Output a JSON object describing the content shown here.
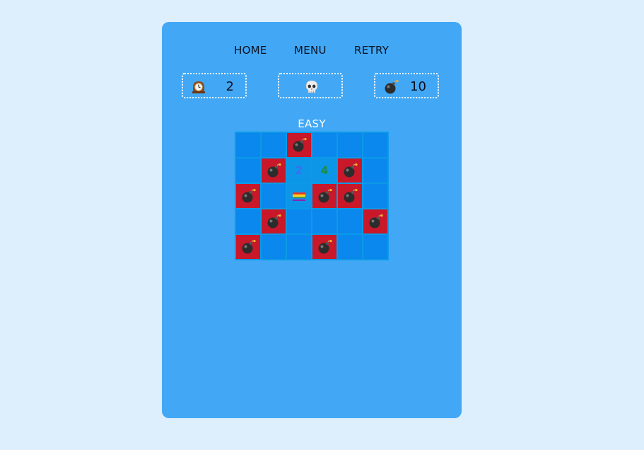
{
  "nav": {
    "home_label": "HOME",
    "menu_label": "MENU",
    "retry_label": "RETRY"
  },
  "stats": {
    "timer_icon": "mantelpiece-clock-icon",
    "timer_value": "2",
    "face_icon": "skull-icon",
    "mines_icon": "bomb-icon",
    "mines_value": "10"
  },
  "level": "EASY",
  "board": {
    "rows": 5,
    "cols": 6,
    "cells": [
      [
        "hidden",
        "hidden",
        "mine",
        "hidden",
        "hidden",
        "hidden"
      ],
      [
        "hidden",
        "mine",
        "num:2",
        "num:4",
        "mine",
        "hidden"
      ],
      [
        "mine",
        "hidden",
        "flag",
        "mine",
        "mine",
        "hidden"
      ],
      [
        "hidden",
        "mine",
        "hidden",
        "hidden",
        "hidden",
        "mine"
      ],
      [
        "mine",
        "hidden",
        "hidden",
        "mine",
        "hidden",
        "hidden"
      ]
    ],
    "number_colors": {
      "2": "#3b6ff2",
      "4": "#1f8f3a"
    }
  },
  "colors": {
    "page_bg": "#ddeffd",
    "panel_bg": "#42a8f5",
    "cell_hidden": "#0a88ee",
    "cell_mine": "#c8182a",
    "grid_line": "#0c9ae6"
  }
}
